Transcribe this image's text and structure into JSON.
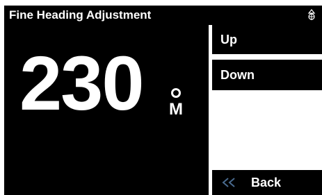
{
  "header": {
    "title": "Fine Heading Adjustment",
    "nav_icon": "ship-wheel-icon"
  },
  "main": {
    "heading_value": "230",
    "degree_symbol_icon": "degree-circle-icon",
    "unit": "M"
  },
  "menu": {
    "up_label": "Up",
    "down_label": "Down",
    "back_label": "Back",
    "back_icon": "double-chevron-left-icon"
  },
  "colors": {
    "background": "#000000",
    "text": "#ffffff",
    "accent_back_icon": "#4a6b8f",
    "divider": "#ffffff"
  }
}
